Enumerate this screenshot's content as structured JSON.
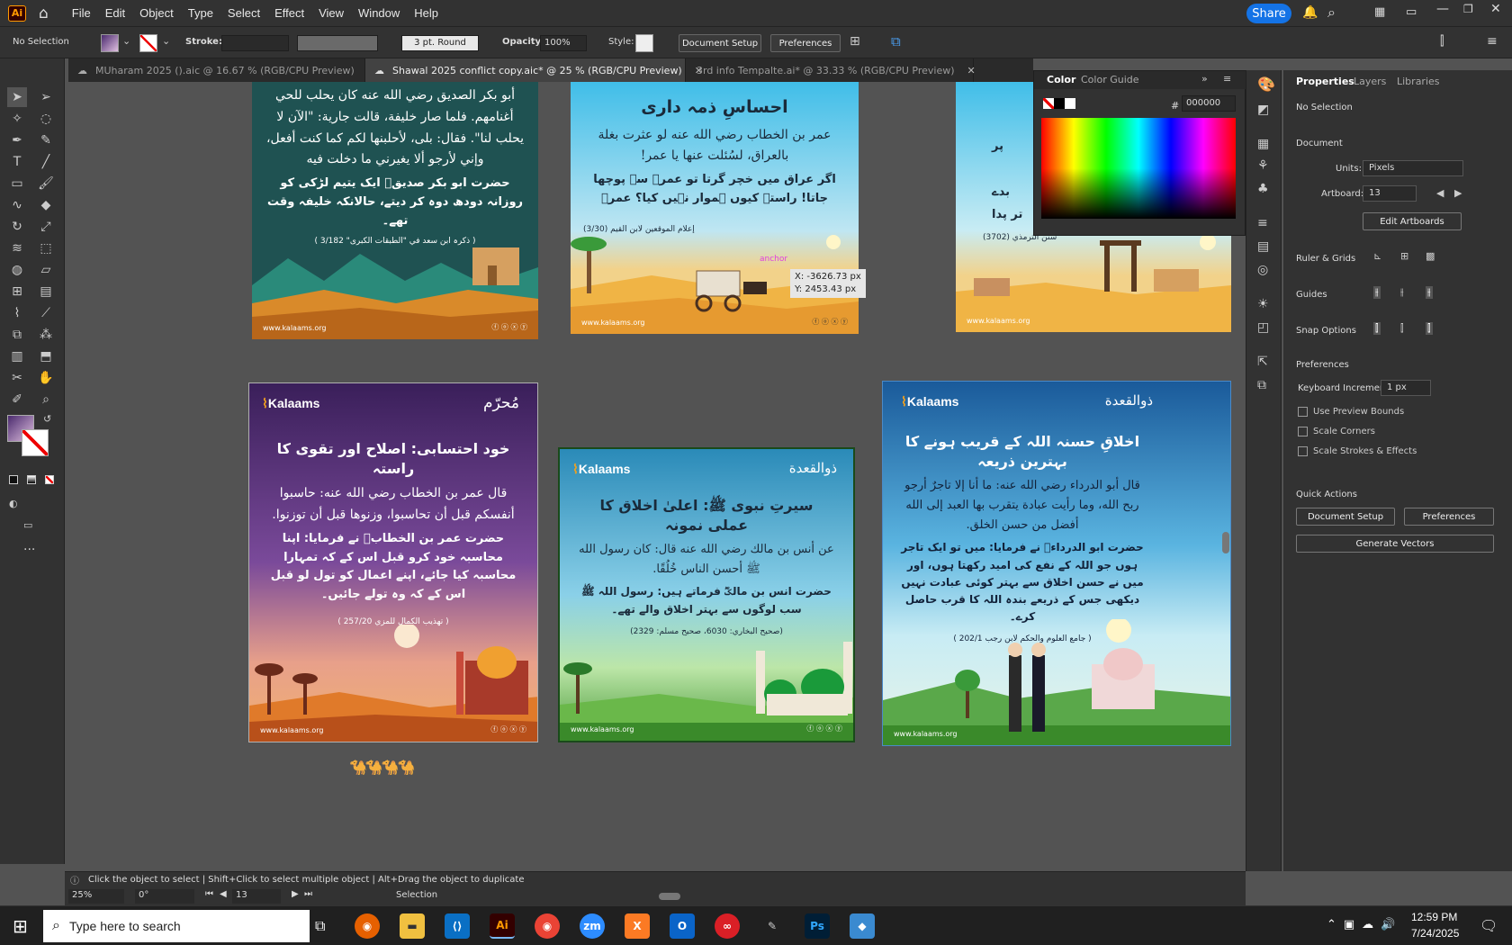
{
  "app": {
    "logo": "Ai"
  },
  "menu": [
    "File",
    "Edit",
    "Object",
    "Type",
    "Select",
    "Effect",
    "View",
    "Window",
    "Help"
  ],
  "share_label": "Share",
  "control": {
    "selection": "No Selection",
    "stroke_label": "Stroke:",
    "brush": "3 pt. Round",
    "opacity_label": "Opacity:",
    "opacity": "100%",
    "style_label": "Style:",
    "doc_setup": "Document Setup",
    "preferences": "Preferences"
  },
  "tabs": [
    {
      "label": "MUharam 2025 ().aic @ 16.67 % (RGB/CPU Preview)"
    },
    {
      "label": "Shawal 2025 conflict copy.aic* @ 25 % (RGB/CPU Preview)"
    },
    {
      "label": "3rd info Tempalte.ai* @ 33.33 % (RGB/CPU Preview)"
    }
  ],
  "color_panel": {
    "tab1": "Color",
    "tab2": "Color Guide",
    "hash": "#",
    "hex": "000000"
  },
  "properties": {
    "tabs": [
      "Properties",
      "Layers",
      "Libraries"
    ],
    "no_selection": "No Selection",
    "document": "Document",
    "units_label": "Units:",
    "units": "Pixels",
    "artboard_label": "Artboard:",
    "artboard": "13",
    "edit_artboards": "Edit Artboards",
    "ruler_grids": "Ruler & Grids",
    "guides": "Guides",
    "snap_options": "Snap Options",
    "preferences": "Preferences",
    "keyboard_increment_label": "Keyboard Increment:",
    "keyboard_increment": "1 px",
    "checks": [
      "Use Preview Bounds",
      "Scale Corners",
      "Scale Strokes & Effects"
    ],
    "quick_actions": "Quick Actions",
    "doc_setup": "Document Setup",
    "prefs_btn": "Preferences",
    "generate_vectors": "Generate Vectors"
  },
  "artboards": {
    "a1": {
      "arabic": "أبو بكر الصديق رضي الله عنه كان يحلب للحي أغنامهم. فلما صار خليفة، قالت جارية: \"الآن لا يحلب لنا\". فقال: بلى، لأحلبنها لكم كما كنت أفعل، وإني لأرجو ألا يغيرني ما دخلت فيه",
      "urdu": "حضرت ابو بکر صدیقؓ ایک یتیم لڑکی کو روزانہ دودھ دوہ کر دیتے، حالانکہ خلیفہ وقت تھے۔",
      "source": "( ذکرہ ابن سعد في \"الطبقات الکبری\" 3/182 )",
      "web": "www.kalaams.org"
    },
    "a2": {
      "title": "احساسِ ذمہ داری",
      "arabic": "عمر بن الخطاب رضي الله عنه لو عثرت بغلة بالعراق، لسُئلت عنها يا عمر!",
      "urdu": "اگر عراق میں خچر گرتا تو عمرؓ سے پوچھا جاتا! راستہ کیوں ہموار نہیں کیا؟ عمرؓ",
      "source": "إعلام الموقعين لابن القيم (3/30)",
      "anchor": "anchor",
      "tooltip_x": "X: -3626.73 px",
      "tooltip_y": "Y: 2453.43 px",
      "web": "www.kalaams.org"
    },
    "a3": {
      "line1": "پر",
      "line2": "بدے",
      "line3": "تر پدا",
      "source": "سنن الترمذي (3702)",
      "web": "www.kalaams.org"
    },
    "a4": {
      "logo": "Kalaams",
      "badge": "مُحرّم",
      "title": "خود احتسابی: اصلاح اور تقوی کا راستہ",
      "arabic": "قال عمر بن الخطاب رضي الله عنه: حاسبوا أنفسكم قبل أن تحاسبوا، وزنوها قبل أن توزنوا.",
      "urdu": "حضرت عمر بن الخطابؓ نے فرمایا: اپنا محاسبہ خود کرو قبل اس کے کہ تمہارا محاسبہ کیا جائے، اپنے اعمال کو تول لو قبل اس کے کہ وہ تولے جائیں۔",
      "source": "( تهذيب الكمال للمزي 257/20 )",
      "web": "www.kalaams.org"
    },
    "a5": {
      "logo": "Kalaams",
      "badge": "ذوالقعدة",
      "title": "سیرتِ نبوی ﷺ: اعلیٰ اخلاق کا عملی نمونہ",
      "arabic": "عن أنس بن مالك رضي الله عنه قال: كان رسول الله ﷺ أحسن الناس خُلُقًا.",
      "urdu": "حضرت انس بن مالکؓ فرماتے ہیں: رسول اللہ ﷺ سب لوگوں سے بہتر اخلاق والے تھے۔",
      "source": "(صحيح البخاري: 6030، صحيح مسلم: 2329)",
      "web": "www.kalaams.org"
    },
    "a6": {
      "logo": "Kalaams",
      "badge": "ذوالقعدة",
      "title": "اخلاقِ حسنہ اللہ کے قریب ہونے کا بہترین ذریعہ",
      "arabic": "قال أبو الدرداء رضي الله عنه: ما أنا إلا تاجرٌ أرجو ربح الله، وما رأيت عبادة يتقرب بها العبد إلى الله أفضل من حسن الخلق.",
      "urdu": "حضرت ابو الدرداءؓ نے فرمایا: میں تو ایک تاجر ہوں جو اللہ کے نفع کی امید رکھتا ہوں، اور میں نے حسن اخلاق سے بہتر کوئی عبادت نہیں دیکھی جس کے ذریعے بندہ اللہ کا قرب حاصل کرے۔",
      "source": "( جامع العلوم والحكم لابن رجب 202/1 )",
      "web": "www.kalaams.org"
    }
  },
  "status": {
    "hint": "Click the object to select  |  Shift+Click to select multiple object  |  Alt+Drag the object to duplicate",
    "zoom": "25%",
    "rotate": "0°",
    "artboard_num": "13",
    "mode": "Selection"
  },
  "taskbar": {
    "search_placeholder": "Type here to search",
    "time": "12:59 PM",
    "date": "7/24/2025"
  },
  "colors": {
    "accent": "#1473e6",
    "chrome": "#323232",
    "canvas": "#535353"
  }
}
